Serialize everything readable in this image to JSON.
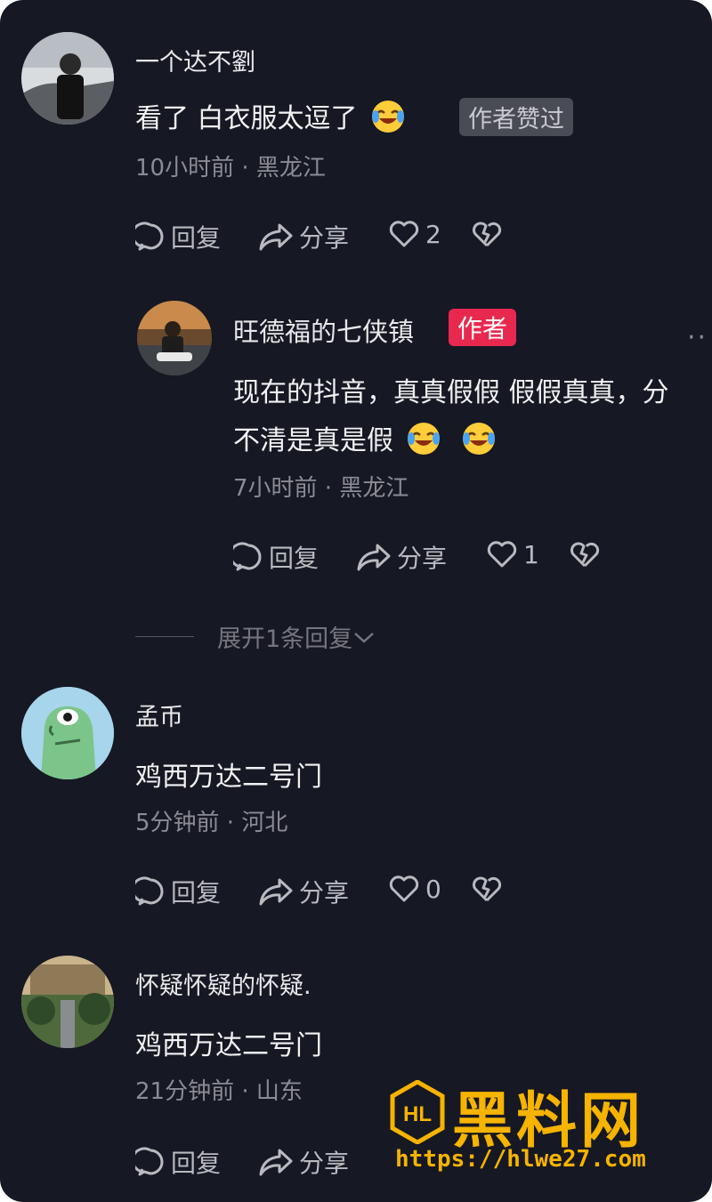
{
  "comments": [
    {
      "username": "一个达不劉",
      "text": "看了 白衣服太逗了",
      "liked_badge": "作者赞过",
      "meta": "10小时前 · 黑龙江",
      "reply_label": "回复",
      "share_label": "分享",
      "likes": "2"
    },
    {
      "username": "孟币",
      "text": "鸡西万达二号门",
      "meta": "5分钟前 · 河北",
      "reply_label": "回复",
      "share_label": "分享",
      "likes": "0"
    },
    {
      "username": "怀疑怀疑的怀疑.",
      "text": "鸡西万达二号门",
      "meta": "21分钟前 · 山东",
      "reply_label": "回复",
      "share_label": "分享"
    }
  ],
  "reply": {
    "username": "旺德福的七侠镇",
    "author_badge": "作者",
    "text_line1": "现在的抖音，真真假假 假假真真，分",
    "text_line2": "不清是真是假",
    "meta": "7小时前 · 黑龙江",
    "reply_label": "回复",
    "share_label": "分享",
    "likes": "1",
    "more": "··"
  },
  "expand_replies": "展开1条回复",
  "watermark": {
    "title": "黑料网",
    "url": "https://hlwe27.com",
    "logo_text": "HL"
  },
  "colors": {
    "background": "#161823",
    "author_badge": "#e9284f",
    "watermark": "#f6b400"
  }
}
